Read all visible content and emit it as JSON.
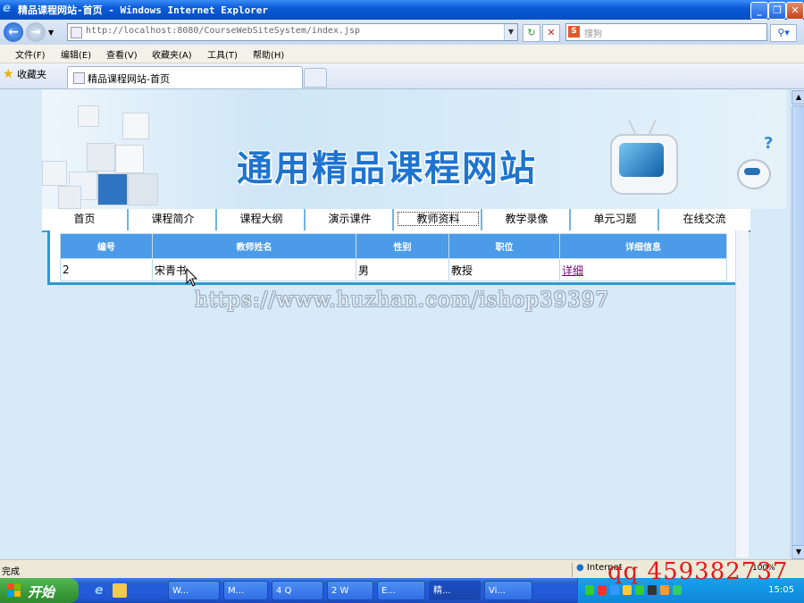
{
  "window": {
    "title": "精品课程网站-首页 - Windows Internet Explorer",
    "address": "http://localhost:8080/CourseWebSiteSystem/index.jsp",
    "search_placeholder": "搜狗"
  },
  "menu": [
    "文件(F)",
    "编辑(E)",
    "查看(V)",
    "收藏夹(A)",
    "工具(T)",
    "帮助(H)"
  ],
  "favorites": {
    "label": "收藏夹",
    "tab_title": "精品课程网站-首页"
  },
  "site": {
    "title": "通用精品课程网站",
    "nav": [
      "首页",
      "课程简介",
      "课程大纲",
      "演示课件",
      "教师资料",
      "教学录像",
      "单元习题",
      "在线交流"
    ],
    "active_nav": "教师资料"
  },
  "teacher_table": {
    "headers": [
      "编号",
      "教师姓名",
      "性别",
      "职位",
      "详细信息"
    ],
    "rows": [
      {
        "id": "2",
        "name": "宋青书",
        "gender": "男",
        "position": "教授",
        "detail": "详细"
      }
    ]
  },
  "watermark": "https://www.huzhan.com/ishop39397",
  "status": {
    "text": "完成",
    "zone": "Internet",
    "zoom": "100%"
  },
  "taskbar": {
    "start": "开始",
    "tasks": [
      "W...",
      "M...",
      "4 Q",
      "2 W",
      "E...",
      "精...",
      "Vi..."
    ],
    "clock": "15:05"
  },
  "overlay_text": "qq 459382737",
  "colors": {
    "accent": "#1e74cf",
    "header_blue": "#4b9be8",
    "border_blue": "#2a9bd0"
  }
}
